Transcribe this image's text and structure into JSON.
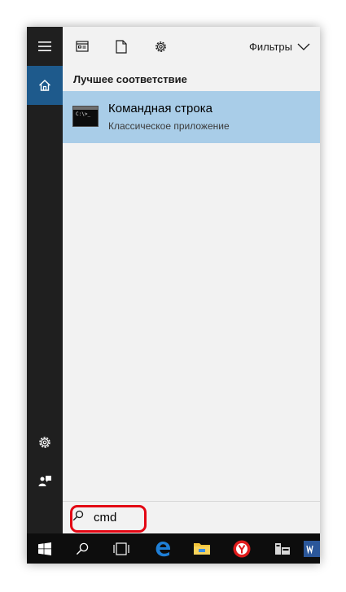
{
  "toolbar": {
    "filters_label": "Фильтры"
  },
  "results": {
    "section_title": "Лучшее соответствие",
    "best_match": {
      "name": "Командная строка",
      "subtitle": "Классическое приложение",
      "icon_prompt": "C:\\>_"
    }
  },
  "search": {
    "value": "cmd"
  },
  "icons": {
    "rail": [
      "hamburger-menu-icon",
      "home-icon",
      "settings-gear-icon",
      "feedback-person-icon"
    ],
    "toolbar": [
      "apps-icon",
      "documents-icon",
      "settings-icon",
      "chevron-down-icon"
    ],
    "taskbar": [
      "windows-start-icon",
      "search-icon",
      "task-view-icon",
      "edge-browser-icon",
      "file-explorer-icon",
      "yandex-browser-icon",
      "app-icon",
      "word-icon"
    ]
  },
  "colors": {
    "rail_bg": "#1f1f1f",
    "active_home": "#1e5a8c",
    "panel_bg": "#f2f2f2",
    "selection": "#a9cde8",
    "taskbar_bg": "#0d0d0d",
    "highlight_outline": "#e30613",
    "edge_blue": "#1f7fd6",
    "yandex_red": "#e01c1c",
    "folder_yellow": "#f3c43a",
    "word_blue": "#2b579a"
  }
}
